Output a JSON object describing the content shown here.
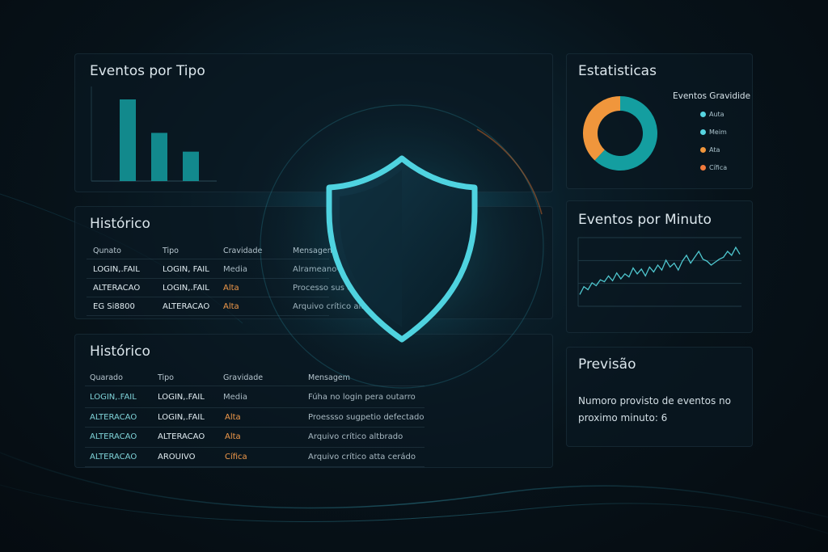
{
  "colors": {
    "teal": "#149ea0",
    "orange": "#f0963c",
    "accent_cyan": "#56d4e0",
    "panel_bg": "#0a1821"
  },
  "events_by_type": {
    "title": "Eventos por Tipo",
    "chart_data": {
      "type": "bar",
      "categories": [
        "",
        "",
        ""
      ],
      "values": [
        100,
        59,
        36
      ],
      "title": "Eventos por Tipo",
      "xlabel": "",
      "ylabel": "",
      "ylim": [
        0,
        100
      ],
      "grid": false
    }
  },
  "history_small": {
    "title": "Histórico",
    "headers": [
      "Qunato",
      "Tipo",
      "Cravidade",
      "Mensagem"
    ],
    "rows": [
      [
        "LOGIN,.FAIL",
        "LOGIN, FAIL",
        "Media",
        "Alrameano-rio"
      ],
      [
        "ALTERACAO",
        "LOGIN,.FAIL",
        "Alta",
        "Processo sus ooo"
      ],
      [
        "EG Si8800",
        "ALTERACAO",
        "Alta",
        "Arquivo crítico altad"
      ]
    ]
  },
  "history_large": {
    "title": "Histórico",
    "headers": [
      "Quarado",
      "Tipo",
      "Gravidade",
      "Mensagem"
    ],
    "rows": [
      [
        "LOGIN,.FAIL",
        "LOGIN,.FAIL",
        "Media",
        "Fúha no login pera outarro"
      ],
      [
        "ALTERACAO",
        "LOGIN,.FAIL",
        "Alta",
        "Proessso sugpetio defectado"
      ],
      [
        "ALTERACAO",
        "ALTERACAO",
        "Alta",
        "Arquivo crítico altbrado"
      ],
      [
        "ALTERACAO",
        "AROUIVO",
        "Cífica",
        "Arquivo crítico atta cerádo"
      ]
    ]
  },
  "statistics": {
    "title": "Estatisticas",
    "legend_title": "Eventos Gravidide",
    "chart_data": {
      "type": "pie",
      "donut": true,
      "slices": [
        {
          "label": "Auta",
          "value": 62,
          "color": "#149ea0"
        },
        {
          "label": "Meim",
          "value": 0,
          "color": "#56d4e0"
        },
        {
          "label": "Ata",
          "value": 38,
          "color": "#f0963c"
        },
        {
          "label": "Cífica",
          "value": 0,
          "color": "#f07a3c"
        }
      ],
      "legend_position": "right"
    },
    "legend": [
      {
        "label": "Auta",
        "color": "#56d4e0"
      },
      {
        "label": "Meim",
        "color": "#56d4e0"
      },
      {
        "label": "Ata",
        "color": "#f0963c"
      },
      {
        "label": "Cífica",
        "color": "#f07a3c"
      }
    ]
  },
  "events_per_minute": {
    "title": "Eventos por Minuto",
    "chart_data": {
      "type": "line",
      "x": [
        0,
        1,
        2,
        3,
        4,
        5,
        6,
        7,
        8,
        9,
        10,
        11,
        12,
        13,
        14,
        15,
        16,
        17,
        18,
        19,
        20,
        21,
        22,
        23,
        24,
        25,
        26,
        27,
        28,
        29,
        30,
        31,
        32,
        33,
        34,
        35,
        36,
        37,
        38,
        39
      ],
      "series": [
        {
          "values": [
            12,
            20,
            17,
            24,
            21,
            27,
            25,
            31,
            26,
            34,
            28,
            33,
            30,
            39,
            33,
            38,
            31,
            40,
            35,
            42,
            37,
            47,
            40,
            44,
            37,
            46,
            52,
            44,
            50,
            56,
            48,
            46,
            42,
            45,
            48,
            50,
            56,
            52,
            60,
            53
          ]
        }
      ],
      "ylim": [
        0,
        70
      ],
      "grid": true
    }
  },
  "forecast": {
    "title": "Previsão",
    "line1": "Numoro provisto de eventos no",
    "line2": "proximo minuto: 6"
  }
}
